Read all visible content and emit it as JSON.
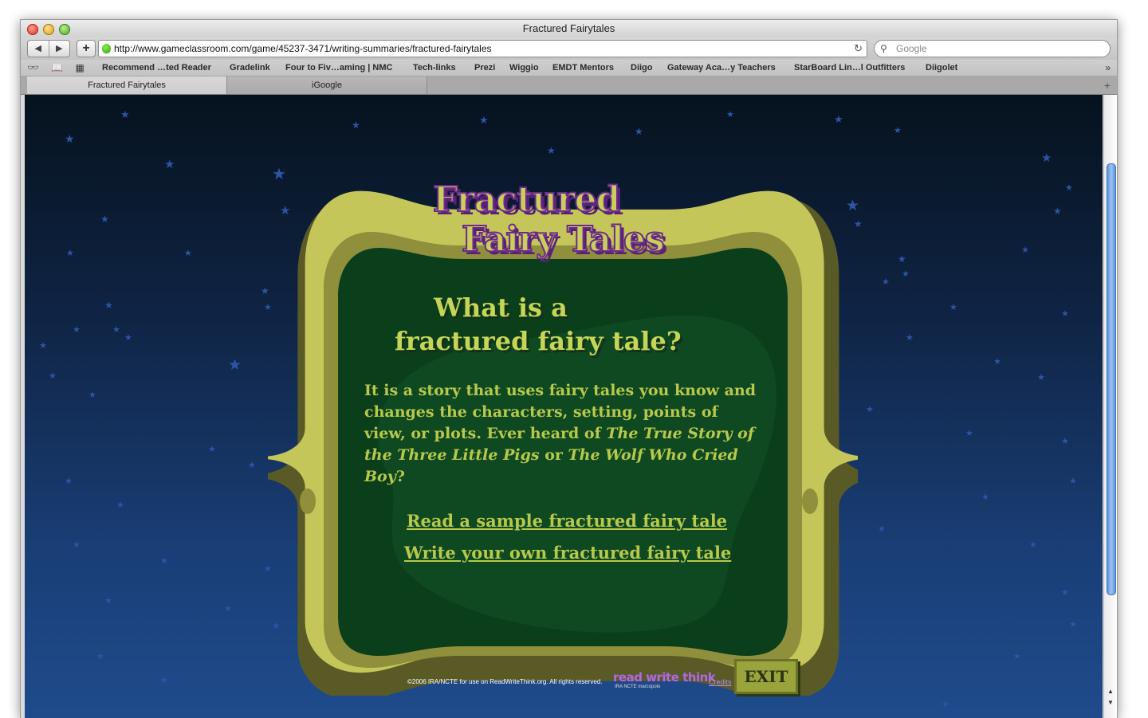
{
  "browser": {
    "window_title": "Fractured Fairytales",
    "url": "http://www.gameclassroom.com/game/45237-3471/writing-summaries/fractured-fairytales",
    "search_placeholder": "Google",
    "nav_back": "◀",
    "nav_forward": "▶",
    "add_button": "+",
    "reload_icon": "↻",
    "search_icon": "🔍",
    "bookmarks_bar_icons": "👓 📖 ▦",
    "bookmarks_more": "»",
    "bookmarks": [
      "Recommend …ted Reader",
      "Gradelink",
      "Four to Fiv…aming | NMC",
      "Tech-links",
      "Prezi",
      "Wiggio",
      "EMDT Mentors",
      "Diigo",
      "Gateway Aca…y Teachers",
      "StarBoard Lin…l Outfitters",
      "Diigolet"
    ],
    "tabs": [
      {
        "label": "Fractured Fairytales",
        "active": true
      },
      {
        "label": "iGoogle",
        "active": false
      }
    ],
    "new_tab": "+"
  },
  "game": {
    "logo_line1": "Fractured",
    "logo_line2": "Fairy Tales",
    "heading_line1": "What is a",
    "heading_line2": "fractured fairy tale?",
    "body_part1": "It is a story that uses fairy tales you know and changes the characters, setting, points of view, or plots. Ever heard of ",
    "body_title1": "The True Story of the Three Little Pigs",
    "body_part2": " or ",
    "body_title2": "The Wolf Who Cried Boy",
    "body_part3": "?",
    "link_read": "Read a sample fractured fairy tale",
    "link_write": "Write your own fractured fairy tale",
    "exit_label": "EXIT",
    "copyright": "©2006 IRA/NCTE for use on ReadWriteThink.org. All rights reserved.",
    "rwt_logo": "read write think",
    "rwt_partners": "IRA  NCTE  marcopolo",
    "credits_label": "Credits"
  },
  "colors": {
    "frame_yellow": "#c5c65a",
    "frame_shadow": "#5a5a26",
    "panel_green": "#0b3f1c",
    "text_yellow_green": "#b8c84c",
    "sky_top": "#06121e",
    "sky_bottom": "#1f4b8c",
    "star": "#2c55a6"
  }
}
